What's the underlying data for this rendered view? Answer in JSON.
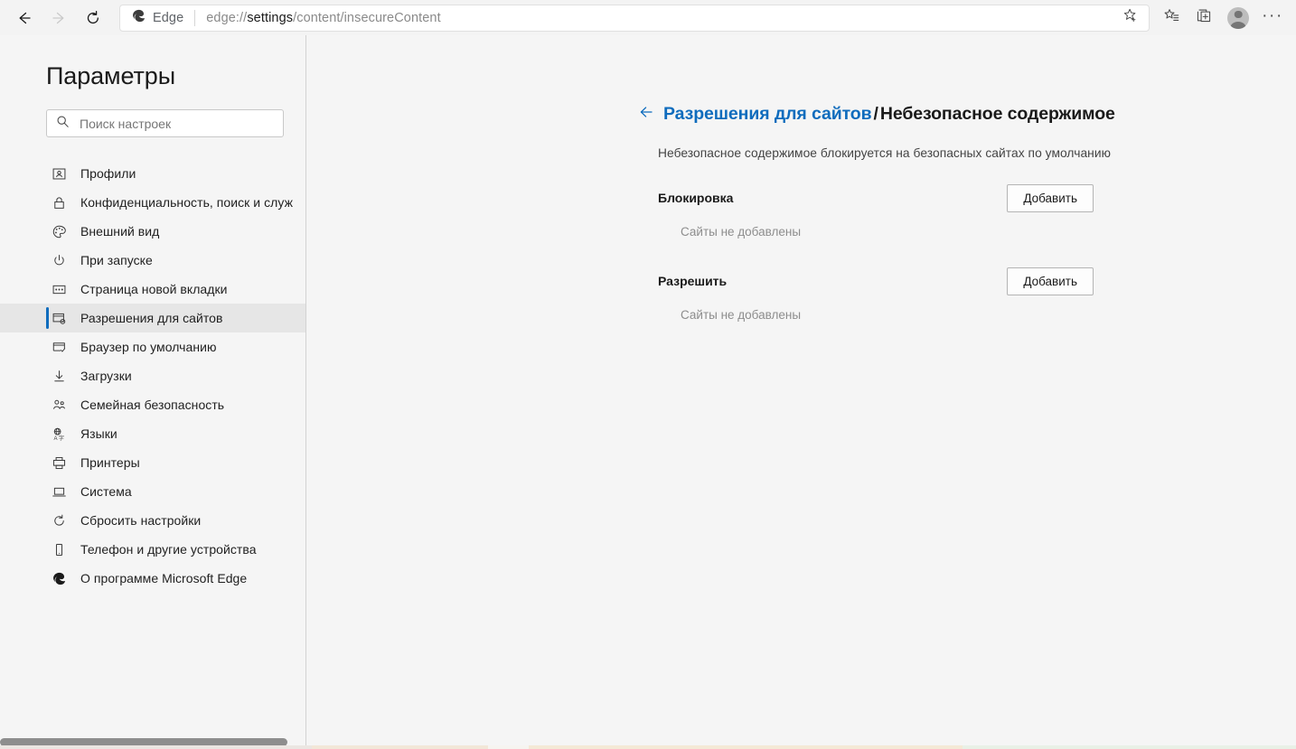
{
  "browser": {
    "back_icon": "back-arrow-icon",
    "forward_icon": "forward-arrow-icon",
    "refresh_icon": "refresh-icon",
    "brand_label": "Edge",
    "url_prefix": "edge://",
    "url_strong": "settings",
    "url_suffix": "/content/insecureContent",
    "favorite_icon": "star-add-icon",
    "collections_icon": "favorites-list-icon",
    "tab_collection_icon": "add-tab-group-icon",
    "profile_icon": "profile-avatar",
    "menu_icon": "more-options-icon"
  },
  "sidebar": {
    "title": "Параметры",
    "search": {
      "placeholder": "Поиск настроек",
      "value": "",
      "icon": "search-icon"
    },
    "items": [
      {
        "label": "Профили",
        "icon": "profile-card-icon",
        "selected": false
      },
      {
        "label": "Конфиденциальность, поиск и служ",
        "icon": "lock-icon",
        "selected": false
      },
      {
        "label": "Внешний вид",
        "icon": "palette-icon",
        "selected": false
      },
      {
        "label": "При запуске",
        "icon": "power-icon",
        "selected": false
      },
      {
        "label": "Страница новой вкладки",
        "icon": "new-tab-page-icon",
        "selected": false
      },
      {
        "label": "Разрешения для сайтов",
        "icon": "site-permissions-icon",
        "selected": true
      },
      {
        "label": "Браузер по умолчанию",
        "icon": "default-browser-icon",
        "selected": false
      },
      {
        "label": "Загрузки",
        "icon": "download-icon",
        "selected": false
      },
      {
        "label": "Семейная безопасность",
        "icon": "family-safety-icon",
        "selected": false
      },
      {
        "label": "Языки",
        "icon": "languages-icon",
        "selected": false
      },
      {
        "label": "Принтеры",
        "icon": "printer-icon",
        "selected": false
      },
      {
        "label": "Система",
        "icon": "system-laptop-icon",
        "selected": false
      },
      {
        "label": "Сбросить настройки",
        "icon": "reset-icon",
        "selected": false
      },
      {
        "label": "Телефон и другие устройства",
        "icon": "phone-icon",
        "selected": false
      },
      {
        "label": "О программе Microsoft Edge",
        "icon": "edge-logo-icon",
        "selected": false
      }
    ]
  },
  "main": {
    "back_icon": "back-arrow-icon",
    "breadcrumb_parent": "Разрешения для сайтов",
    "breadcrumb_separator": "/",
    "breadcrumb_current": "Небезопасное содержимое",
    "description": "Небезопасное содержимое блокируется на безопасных сайтах по умолчанию",
    "sections": [
      {
        "title": "Блокировка",
        "button_label": "Добавить",
        "empty_text": "Сайты не добавлены"
      },
      {
        "title": "Разрешить",
        "button_label": "Добавить",
        "empty_text": "Сайты не добавлены"
      }
    ]
  },
  "colors": {
    "accent": "#0f6cbd",
    "page_bg": "#f5f5f5",
    "selected_bg": "#e6e6e6",
    "muted_text": "#8d8d8d"
  }
}
